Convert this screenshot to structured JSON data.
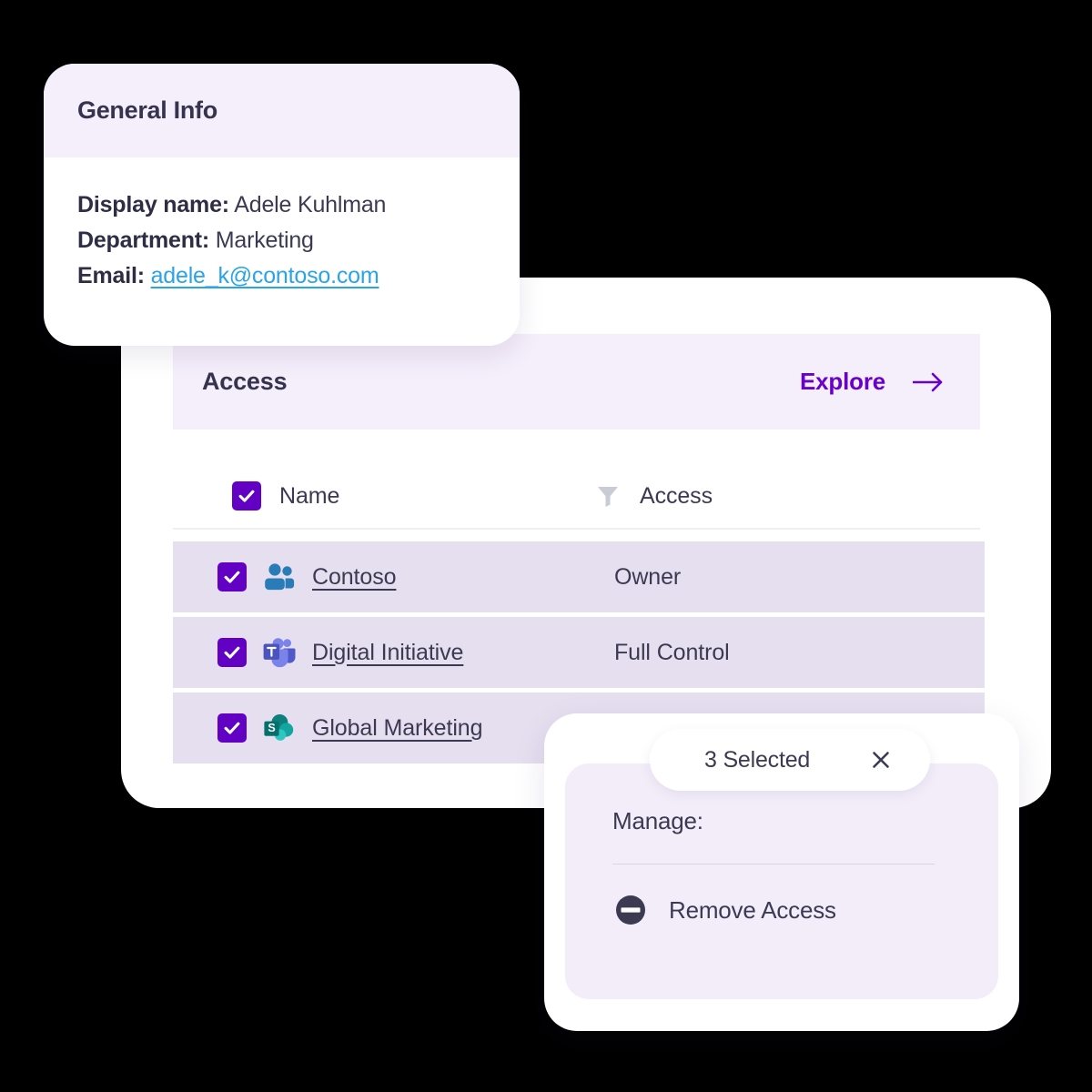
{
  "colors": {
    "accent_purple": "#6a01c8",
    "checkbox_purple": "#6200c4",
    "header_band": "#f5eefb",
    "row_bg": "#e6dff0",
    "text_dark": "#3c3a52",
    "link_blue": "#2aa3e8",
    "manage_panel": "#f3edfa",
    "filter_gray": "#c9ccd6",
    "background": "#000000"
  },
  "info_card": {
    "title": "General Info",
    "fields": [
      {
        "label": "Display name:",
        "value": "Adele Kuhlman",
        "is_link": false
      },
      {
        "label": "Department:",
        "value": "Marketing",
        "is_link": false
      },
      {
        "label": "Email:",
        "value": "adele_k@contoso.com",
        "is_link": true
      }
    ]
  },
  "access_card": {
    "title": "Access",
    "explore_label": "Explore",
    "explore_arrow_icon": "arrow-right-icon",
    "table": {
      "columns": [
        {
          "label": "Name",
          "icon": "checkbox-checked-icon"
        },
        {
          "label": "Access",
          "icon": "filter-icon"
        }
      ],
      "header_checkbox_checked": true,
      "rows": [
        {
          "checked": true,
          "icon": "people-group-icon",
          "name": "Contoso ",
          "access": "Owner"
        },
        {
          "checked": true,
          "icon": "microsoft-teams-icon",
          "name": "Digital Initiative ",
          "access": "Full Control"
        },
        {
          "checked": true,
          "icon": "sharepoint-icon",
          "name": "Global Marketing",
          "access": ""
        }
      ]
    }
  },
  "selected_pill": {
    "text": "3 Selected",
    "close_icon": "close-icon"
  },
  "manage_card": {
    "label": "Manage:",
    "actions": [
      {
        "label": "Remove Access",
        "icon": "remove-access-icon"
      }
    ]
  }
}
